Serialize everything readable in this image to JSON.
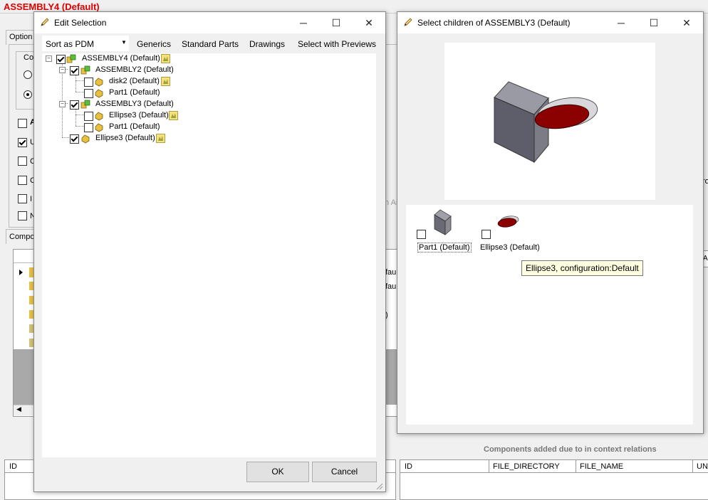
{
  "background": {
    "title": "ASSEMBLY4 (Default)",
    "options_tab": "Option",
    "components_tab": "Compo",
    "bottom_left_grid": {
      "headers": [
        "ID"
      ]
    },
    "right_section_title": "Components added due to in context relations",
    "right_grid": {
      "headers": [
        "ID",
        "FILE_DIRECTORY",
        "FILE_NAME",
        "UN"
      ]
    },
    "fragments": {
      "group_c": "Co",
      "row_a": "A",
      "row_u": "U",
      "row_c1": "C",
      "row_c2": "C",
      "row_i": "I",
      "row_n": "N",
      "as": "n As",
      "ro": "ro",
      "af": "AF",
      "faul1": "faul",
      "faul2": "faul",
      "paren": ")"
    }
  },
  "edit_selection": {
    "title": "Edit Selection",
    "sort_dropdown": "Sort as PDM",
    "menu": [
      "Generics",
      "Standard Parts",
      "Drawings",
      "Select with Previews"
    ],
    "tree": [
      {
        "label": "ASSEMBLY4 (Default)",
        "checked": true,
        "icon": "assembly-icon"
      },
      {
        "label": "ASSEMBLY2 (Default)",
        "checked": true,
        "icon": "assembly-icon"
      },
      {
        "label": "disk2 (Default)",
        "checked": false,
        "icon": "part-icon"
      },
      {
        "label": "Part1 (Default)",
        "checked": false,
        "icon": "part-icon"
      },
      {
        "label": "ASSEMBLY3 (Default)",
        "checked": true,
        "icon": "assembly-icon"
      },
      {
        "label": "Ellipse3 (Default)",
        "checked": false,
        "icon": "part-icon"
      },
      {
        "label": "Part1 (Default)",
        "checked": false,
        "icon": "part-icon"
      },
      {
        "label": "Ellipse3 (Default)",
        "checked": true,
        "icon": "part-icon"
      }
    ],
    "ok_label": "OK",
    "cancel_label": "Cancel"
  },
  "select_children": {
    "title": "Select children of ASSEMBLY3 (Default)",
    "items": [
      {
        "label": "Part1 (Default)",
        "checked": false
      },
      {
        "label": "Ellipse3 (Default)",
        "checked": false
      }
    ],
    "tooltip": "Ellipse3, configuration:Default"
  },
  "window_controls": {
    "minimize": "─",
    "maximize": "☐",
    "close": "✕"
  }
}
